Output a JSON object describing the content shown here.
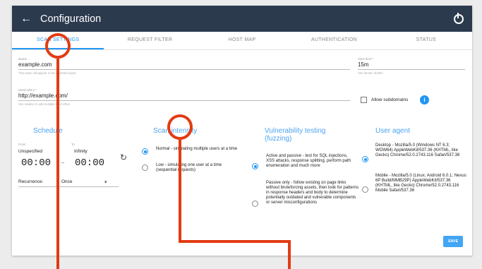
{
  "header": {
    "title": "Configuration",
    "back_icon": "←"
  },
  "tabs": [
    "SCAN SETTINGS",
    "REQUEST FILTER",
    "HOST MAP",
    "AUTHENTICATION",
    "STATUS"
  ],
  "name_field": {
    "label": "Name",
    "value": "example.com",
    "help": "This name will appear in the exported report"
  },
  "time_limit": {
    "label": "Time limit *",
    "value": "15m",
    "help": "Use format: 3h30m"
  },
  "seed_urls": {
    "label": "Seed URLs *",
    "value": "http://example.com/",
    "help": "Use newline to add multiple seed URLs"
  },
  "allow_subdomains": {
    "label": "Allow subdomains",
    "checked": false,
    "info_icon": "i"
  },
  "schedule": {
    "title": "Schedule",
    "from_label": "From",
    "from_value": "Unspecified",
    "to_label": "To",
    "to_value": "Infinity",
    "from_time": "00:00",
    "dots": "--",
    "to_time": "00:00",
    "recurrence_label": "Recurrence:",
    "recurrence_value": "Once",
    "reset_icon": "↻"
  },
  "scan_intensity": {
    "title": "Scan intensity",
    "options": [
      {
        "label": "Normal - simulating multiple users at a time",
        "selected": true
      },
      {
        "label": "Low - simulating one user at a time (sequential requests)",
        "selected": false
      }
    ]
  },
  "vulnerability_testing": {
    "title": "Vulnerability testing (fuzzing)",
    "options": [
      {
        "label": "Active and passive - test for SQL injections, XSS attacks, response splitting, perform path enumeration and much more",
        "selected": true
      },
      {
        "label": "Passive only - follow existing on page links without bruteforcing assets, then look for patterns in response headers and body to determine potentially outdated and vulnerable components or server misconfigurations",
        "selected": false
      }
    ]
  },
  "user_agent": {
    "title": "User agent",
    "options": [
      {
        "label": "Desktop - Mozilla/5.0 (Windows NT 6.3; WOW64) AppleWebKit/537.36 (KHTML, like Gecko) Chrome/52.0.2743.116 Safari/537.36",
        "selected": true
      },
      {
        "label": "Mobile - Mozilla/5.0 (Linux; Android 6.0.1; Nexus 6P Build/MMB29P) AppleWebKit/537.36 (KHTML, like Gecko) Chrome/52.0.2743.116 Mobile Safari/537.36",
        "selected": false
      }
    ]
  },
  "save_label": "SAVE",
  "colors": {
    "header": "#2c3a4e",
    "accent": "#2196f3",
    "annotation": "#e23b12"
  }
}
